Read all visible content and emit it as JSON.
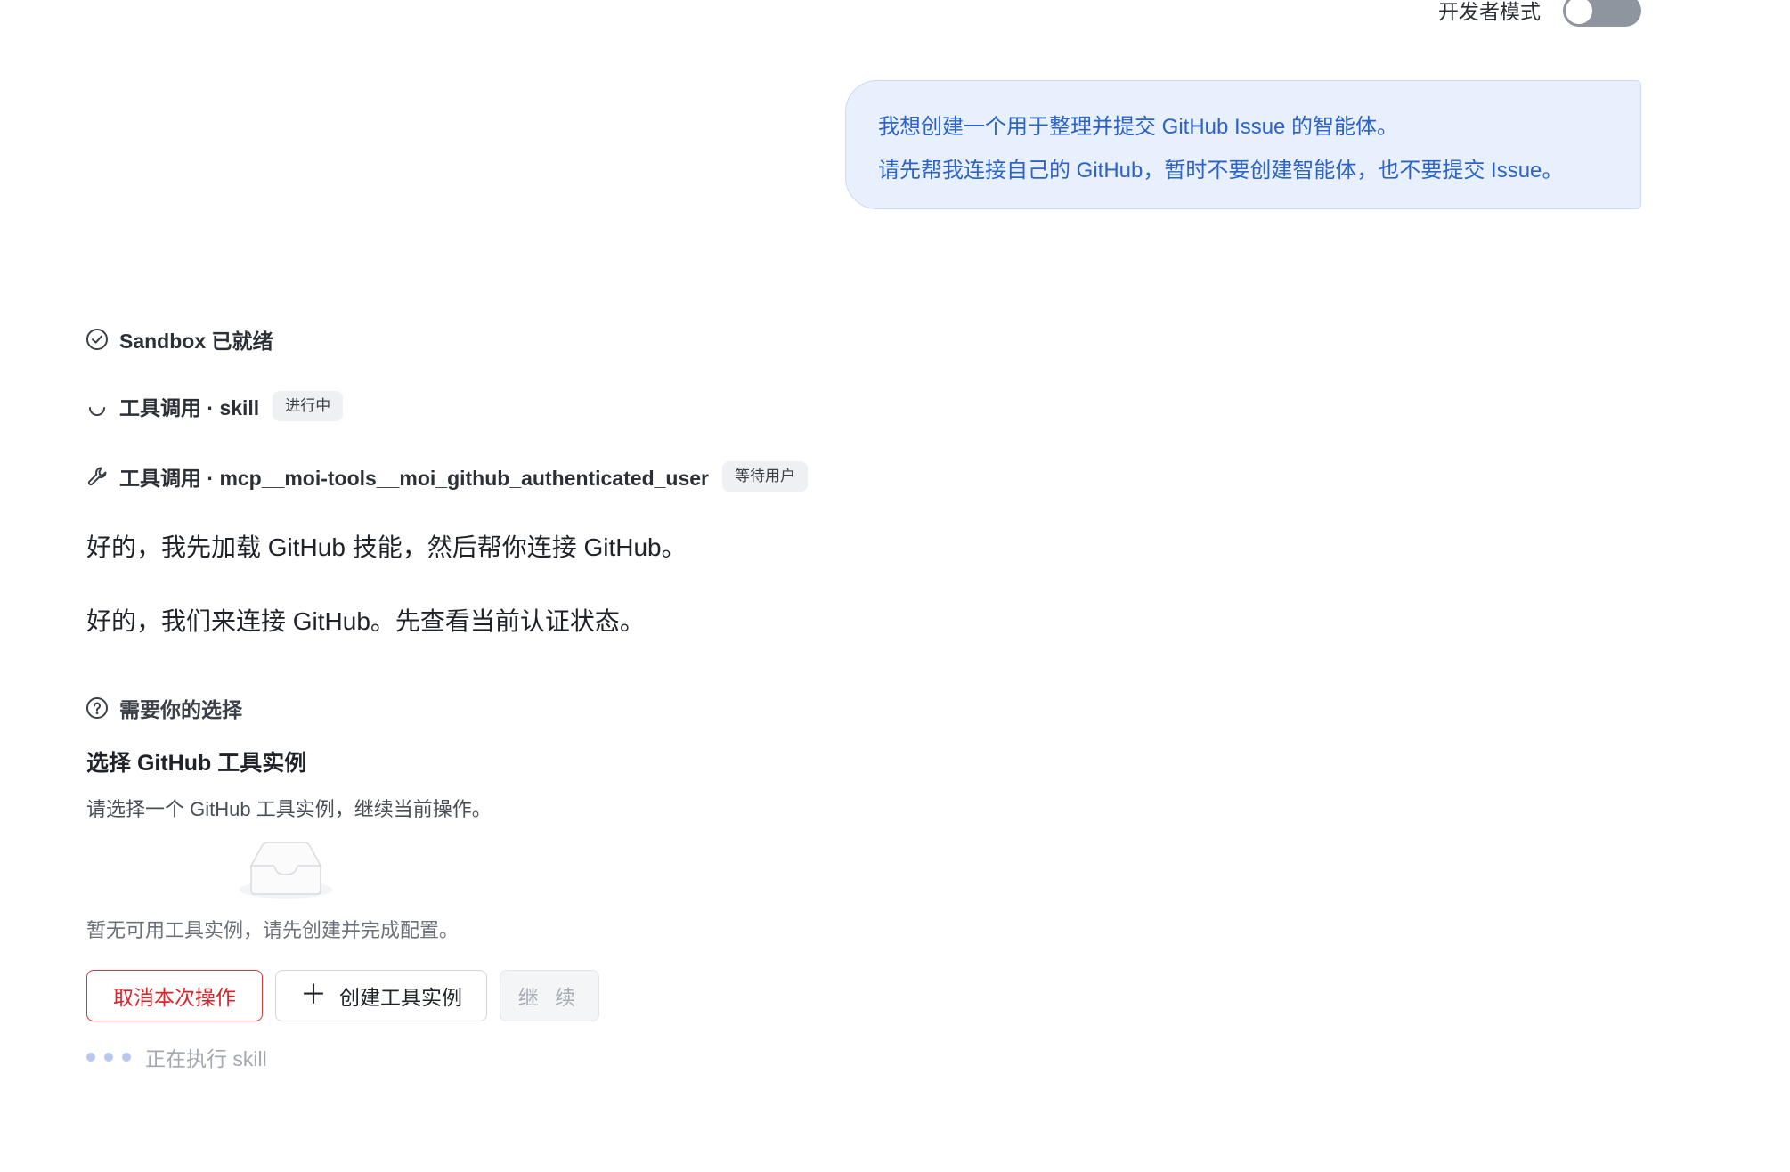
{
  "header": {
    "dev_mode_label": "开发者模式",
    "dev_mode_on": false
  },
  "user_message": {
    "line1": "我想创建一个用于整理并提交 GitHub Issue 的智能体。",
    "line2": "请先帮我连接自己的 GitHub，暂时不要创建智能体，也不要提交 Issue。"
  },
  "status": {
    "sandbox": {
      "label": "Sandbox 已就绪",
      "icon": "check-circle-icon"
    },
    "tool_skill": {
      "label": "工具调用 · skill",
      "badge": "进行中",
      "icon": "spinner-icon"
    },
    "tool_mcp": {
      "label": "工具调用 · mcp__moi-tools__moi_github_authenticated_user",
      "badge": "等待用户",
      "icon": "wrench-icon"
    }
  },
  "assistant": {
    "msg1": "好的，我先加载 GitHub 技能，然后帮你连接 GitHub。",
    "msg2": "好的，我们来连接 GitHub。先查看当前认证状态。"
  },
  "choice": {
    "header": "需要你的选择",
    "title": "选择 GitHub 工具实例",
    "description": "请选择一个 GitHub 工具实例，继续当前操作。",
    "empty_text": "暂无可用工具实例，请先创建并完成配置。",
    "cancel_label": "取消本次操作",
    "create_label": "创建工具实例",
    "continue_label": "继 续"
  },
  "running": {
    "text": "正在执行 skill"
  },
  "colors": {
    "accent_blue": "#2d63c8",
    "bubble_bg": "#e8effd",
    "danger": "#d9262c",
    "toggle_off": "#8f959e"
  }
}
